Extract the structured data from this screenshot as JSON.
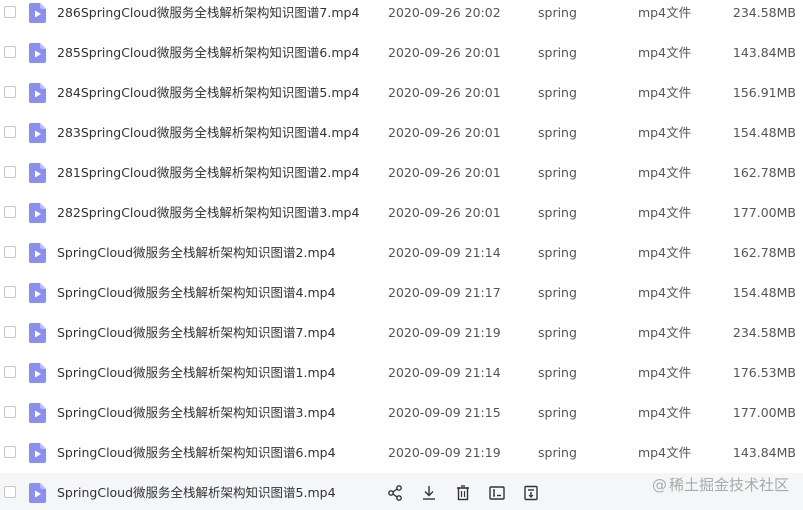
{
  "files": [
    {
      "name": "286SpringCloud微服务全栈解析架构知识图谱7.mp4",
      "modified": "2020-09-26 20:02",
      "owner": "spring",
      "type": "mp4文件",
      "size": "234.58MB"
    },
    {
      "name": "285SpringCloud微服务全栈解析架构知识图谱6.mp4",
      "modified": "2020-09-26 20:01",
      "owner": "spring",
      "type": "mp4文件",
      "size": "143.84MB"
    },
    {
      "name": "284SpringCloud微服务全栈解析架构知识图谱5.mp4",
      "modified": "2020-09-26 20:01",
      "owner": "spring",
      "type": "mp4文件",
      "size": "156.91MB"
    },
    {
      "name": "283SpringCloud微服务全栈解析架构知识图谱4.mp4",
      "modified": "2020-09-26 20:01",
      "owner": "spring",
      "type": "mp4文件",
      "size": "154.48MB"
    },
    {
      "name": "281SpringCloud微服务全栈解析架构知识图谱2.mp4",
      "modified": "2020-09-26 20:01",
      "owner": "spring",
      "type": "mp4文件",
      "size": "162.78MB"
    },
    {
      "name": "282SpringCloud微服务全栈解析架构知识图谱3.mp4",
      "modified": "2020-09-26 20:01",
      "owner": "spring",
      "type": "mp4文件",
      "size": "177.00MB"
    },
    {
      "name": "SpringCloud微服务全栈解析架构知识图谱2.mp4",
      "modified": "2020-09-09 21:14",
      "owner": "spring",
      "type": "mp4文件",
      "size": "162.78MB"
    },
    {
      "name": "SpringCloud微服务全栈解析架构知识图谱4.mp4",
      "modified": "2020-09-09 21:17",
      "owner": "spring",
      "type": "mp4文件",
      "size": "154.48MB"
    },
    {
      "name": "SpringCloud微服务全栈解析架构知识图谱7.mp4",
      "modified": "2020-09-09 21:19",
      "owner": "spring",
      "type": "mp4文件",
      "size": "234.58MB"
    },
    {
      "name": "SpringCloud微服务全栈解析架构知识图谱1.mp4",
      "modified": "2020-09-09 21:14",
      "owner": "spring",
      "type": "mp4文件",
      "size": "176.53MB"
    },
    {
      "name": "SpringCloud微服务全栈解析架构知识图谱3.mp4",
      "modified": "2020-09-09 21:15",
      "owner": "spring",
      "type": "mp4文件",
      "size": "177.00MB"
    },
    {
      "name": "SpringCloud微服务全栈解析架构知识图谱6.mp4",
      "modified": "2020-09-09 21:19",
      "owner": "spring",
      "type": "mp4文件",
      "size": "143.84MB"
    }
  ],
  "hovered_file": {
    "name": "SpringCloud微服务全栈解析架构知识图谱5.mp4",
    "actions": [
      "share-icon",
      "download-icon",
      "delete-icon",
      "rename-icon",
      "more-icon"
    ]
  },
  "watermark": {
    "at": "@",
    "text": "稀土掘金技术社区"
  },
  "colors": {
    "file_icon": "#8b8ff0",
    "hover_row": "#f5f6f8",
    "text": "#333333",
    "muted_text": "#555555",
    "watermark": "#a9a9a9"
  }
}
